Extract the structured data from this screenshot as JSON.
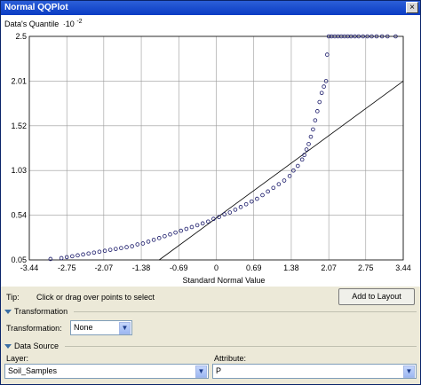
{
  "window": {
    "title": "Normal QQPlot",
    "close_symbol": "×"
  },
  "chart_data": {
    "type": "scatter",
    "ylabel": "Data's Quantile",
    "ylabel_exponent": "·10",
    "ylabel_superscript": "-2",
    "xlabel": "Standard Normal Value",
    "x_ticks": [
      "-3.44",
      "-2.75",
      "-2.07",
      "-1.38",
      "-0.69",
      "0",
      "0.69",
      "1.38",
      "2.07",
      "2.75",
      "3.44"
    ],
    "x_tick_values": [
      -3.44,
      -2.75,
      -2.07,
      -1.38,
      -0.69,
      0,
      0.69,
      1.38,
      2.07,
      2.75,
      3.44
    ],
    "y_ticks": [
      "0.05",
      "0.54",
      "1.03",
      "1.52",
      "2.01",
      "2.5"
    ],
    "y_tick_values": [
      0.05,
      0.54,
      1.03,
      1.52,
      2.01,
      2.5
    ],
    "xlim": [
      -3.44,
      3.44
    ],
    "ylim": [
      0.05,
      2.5
    ],
    "grid": true,
    "reference_line": {
      "x": [
        -1.05,
        3.44
      ],
      "y": [
        0.05,
        2.01
      ]
    },
    "points": {
      "x": [
        -3.05,
        -2.85,
        -2.75,
        -2.65,
        -2.55,
        -2.45,
        -2.35,
        -2.25,
        -2.15,
        -2.05,
        -1.95,
        -1.85,
        -1.75,
        -1.65,
        -1.55,
        -1.45,
        -1.35,
        -1.25,
        -1.15,
        -1.05,
        -0.95,
        -0.85,
        -0.75,
        -0.65,
        -0.55,
        -0.45,
        -0.35,
        -0.25,
        -0.15,
        -0.05,
        0.05,
        0.15,
        0.25,
        0.35,
        0.45,
        0.55,
        0.65,
        0.75,
        0.85,
        0.95,
        1.05,
        1.15,
        1.25,
        1.35,
        1.42,
        1.5,
        1.58,
        1.62,
        1.66,
        1.7,
        1.74,
        1.78,
        1.82,
        1.86,
        1.9,
        1.94,
        1.98,
        2.02,
        2.04,
        2.07,
        2.12,
        2.18,
        2.24,
        2.3,
        2.36,
        2.42,
        2.48,
        2.55,
        2.62,
        2.7,
        2.78,
        2.86,
        2.95,
        3.05,
        3.15,
        3.3
      ],
      "y": [
        0.06,
        0.07,
        0.08,
        0.09,
        0.1,
        0.11,
        0.12,
        0.13,
        0.14,
        0.15,
        0.16,
        0.17,
        0.18,
        0.19,
        0.2,
        0.22,
        0.23,
        0.25,
        0.27,
        0.29,
        0.31,
        0.33,
        0.35,
        0.37,
        0.39,
        0.41,
        0.43,
        0.45,
        0.47,
        0.5,
        0.52,
        0.55,
        0.57,
        0.6,
        0.63,
        0.66,
        0.69,
        0.72,
        0.76,
        0.8,
        0.84,
        0.88,
        0.92,
        0.97,
        1.03,
        1.08,
        1.15,
        1.2,
        1.26,
        1.32,
        1.4,
        1.48,
        1.58,
        1.68,
        1.78,
        1.88,
        1.95,
        2.01,
        2.3,
        2.5,
        2.5,
        2.5,
        2.5,
        2.5,
        2.5,
        2.5,
        2.5,
        2.5,
        2.5,
        2.5,
        2.5,
        2.5,
        2.5,
        2.5,
        2.5,
        2.5
      ]
    }
  },
  "tip": {
    "label": "Tip:",
    "text": "Click or drag over points to select"
  },
  "add_to_layout_label": "Add to Layout",
  "transformation_section": {
    "title": "Transformation",
    "field_label": "Transformation:",
    "value": "None"
  },
  "data_source_section": {
    "title": "Data Source",
    "layer_label": "Layer:",
    "layer_value": "Soil_Samples",
    "attribute_label": "Attribute:",
    "attribute_value": "P"
  },
  "icons": {
    "dropdown": "chevron-down-icon",
    "collapse": "triangle-down-icon"
  },
  "colors": {
    "title_bar": "#0a3cc4",
    "points": "#1b1b6b",
    "grid": "#9a9a9a",
    "panel": "#ece9d8"
  }
}
